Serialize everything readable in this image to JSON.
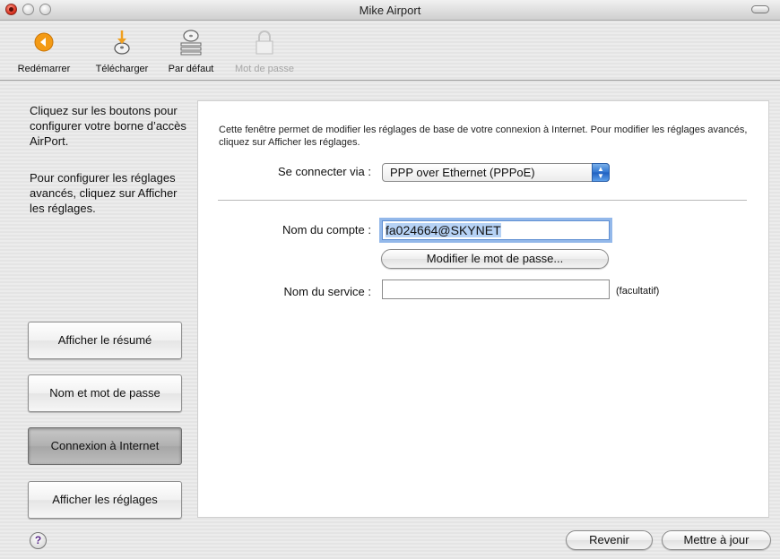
{
  "window": {
    "title": "Mike Airport"
  },
  "toolbar": {
    "items": [
      {
        "label": "Redémarrer",
        "icon": "restart-icon",
        "enabled": true
      },
      {
        "label": "Télécharger",
        "icon": "download-icon",
        "enabled": true
      },
      {
        "label": "Par défaut",
        "icon": "default-icon",
        "enabled": true
      },
      {
        "label": "Mot de passe",
        "icon": "lock-icon",
        "enabled": false
      }
    ]
  },
  "sidebar": {
    "intro1": "Cliquez sur les boutons pour configurer votre borne d’accès AirPort.",
    "intro2": "Pour configurer les réglages avancés, cliquez sur Afficher les réglages.",
    "buttons": [
      {
        "label": "Afficher le résumé",
        "active": false
      },
      {
        "label": "Nom et mot de passe",
        "active": false
      },
      {
        "label": "Connexion à Internet",
        "active": true
      },
      {
        "label": "Afficher les réglages",
        "active": false
      }
    ]
  },
  "main": {
    "intro": "Cette fenêtre permet de modifier les réglages de base de votre connexion à Internet. Pour modifier les réglages avancés, cliquez sur Afficher les réglages.",
    "connect_label": "Se connecter via :",
    "connect_value": "PPP over Ethernet (PPPoE)",
    "account_label": "Nom du compte :",
    "account_value": "fa024664@SKYNET",
    "change_password_button": "Modifier le mot de passe...",
    "service_label": "Nom du service :",
    "service_value": "",
    "optional_note": "(facultatif)"
  },
  "footer": {
    "help": "?",
    "revert_button": "Revenir",
    "update_button": "Mettre à jour"
  },
  "colors": {
    "accent_blue": "#2f74d0",
    "restart_orange": "#f39a14",
    "download_arrow": "#f0a020"
  }
}
